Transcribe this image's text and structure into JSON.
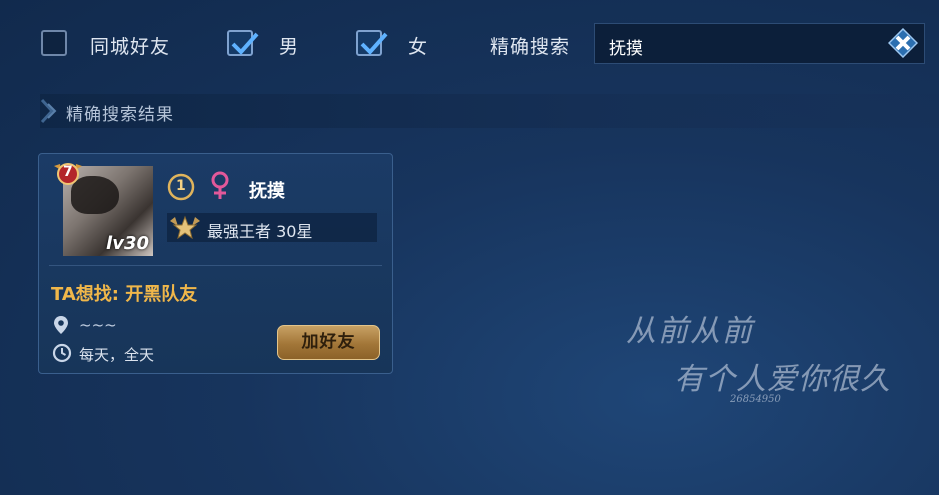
{
  "filters": {
    "same_city": {
      "label": "同城好友",
      "checked": false
    },
    "male": {
      "label": "男",
      "checked": true
    },
    "female": {
      "label": "女",
      "checked": true
    },
    "exact_search_label": "精确搜索"
  },
  "search": {
    "value": "抚摸"
  },
  "section": {
    "title": "精确搜索结果"
  },
  "result": {
    "level_badge": "7",
    "avatar_level": "lv30",
    "tier_badge": "1",
    "name": "抚摸",
    "rank": "最强王者  30星",
    "wants": "TA想找: 开黑队友",
    "location": "~~~",
    "time": "每天，全天",
    "add_button": "加好友"
  },
  "watermark": {
    "line1": "从前从前",
    "line2": "有个人爱你很久",
    "line3": "26854950"
  }
}
